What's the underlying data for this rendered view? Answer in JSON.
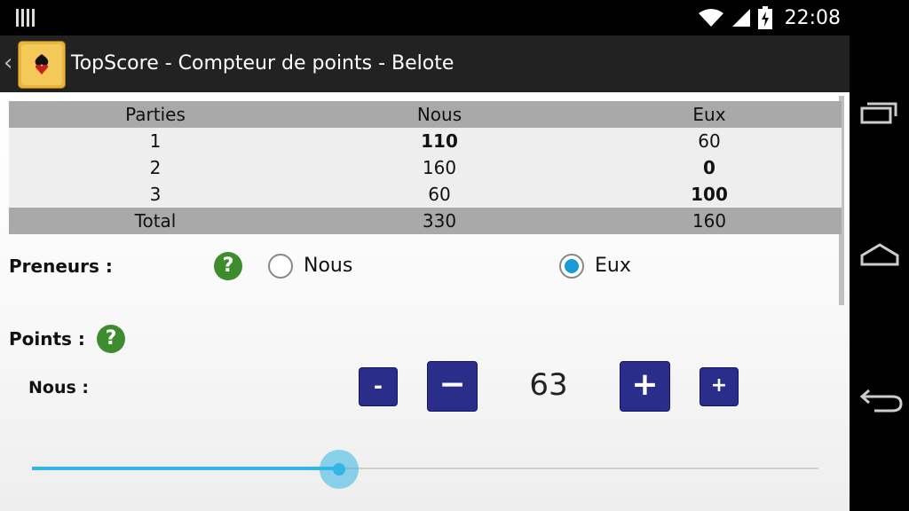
{
  "status": {
    "time": "22:08"
  },
  "app": {
    "title": "TopScore - Compteur de points - Belote"
  },
  "table": {
    "headers": [
      "Parties",
      "Nous",
      "Eux"
    ],
    "rows": [
      [
        "1",
        "110",
        "60"
      ],
      [
        "2",
        "160",
        "0"
      ],
      [
        "3",
        "60",
        "100"
      ]
    ],
    "total": [
      "Total",
      "330",
      "160"
    ]
  },
  "preneurs": {
    "label": "Preneurs :",
    "options": [
      "Nous",
      "Eux"
    ],
    "selected": "Eux"
  },
  "points": {
    "label": "Points :",
    "team_label": "Nous :",
    "value": "63",
    "minus_small": "-",
    "minus_large": "−",
    "plus_large": "+",
    "plus_small": "+",
    "slider_fraction": 0.39
  },
  "help_glyph": "?",
  "colors": {
    "accent": "#33b5e5",
    "button": "#2b2d8b",
    "help": "#3f8c2e"
  }
}
